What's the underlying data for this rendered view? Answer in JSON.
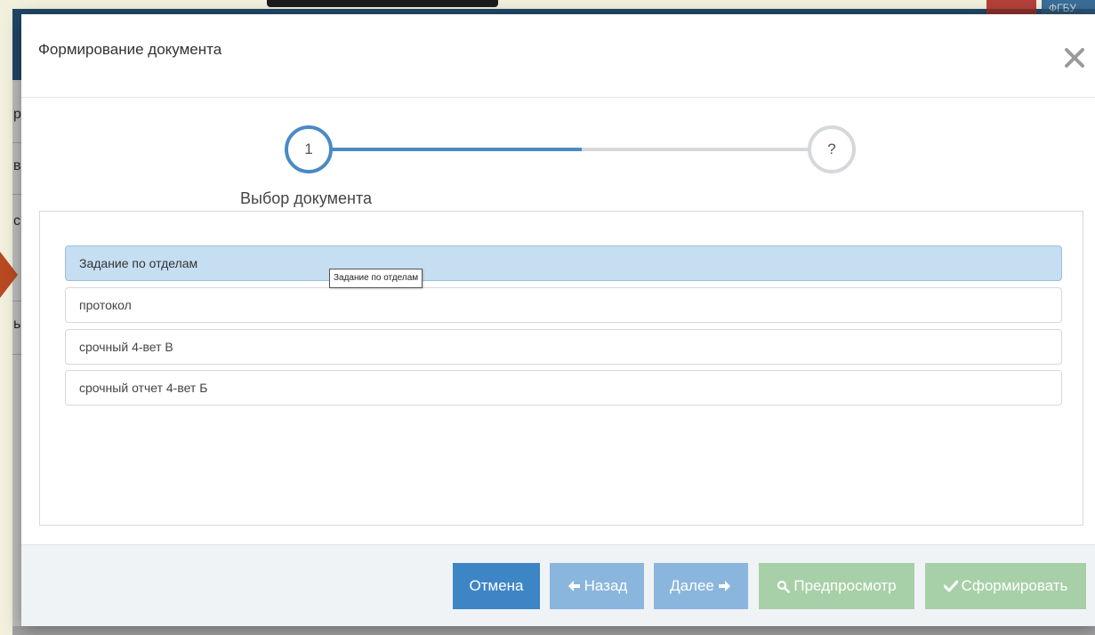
{
  "background": {
    "topbar_right_text": "ФГБУ",
    "side_letters": [
      "р",
      "в",
      "с",
      "ь"
    ]
  },
  "modal": {
    "title": "Формирование документа",
    "close_icon": "close-icon",
    "stepper": {
      "steps": [
        {
          "label": "1",
          "state": "active"
        },
        {
          "label": "?",
          "state": "pending"
        }
      ],
      "current_step_label": "Выбор документа",
      "progress_fraction": 0.5
    },
    "documents": [
      {
        "label": "Задание по отделам",
        "selected": true
      },
      {
        "label": "протокол",
        "selected": false
      },
      {
        "label": "срочный 4-вет В",
        "selected": false
      },
      {
        "label": "срочный отчет 4-вет Б",
        "selected": false
      }
    ],
    "tooltip": "Задание по отделам",
    "footer": {
      "cancel_label": "Отмена",
      "back_label": "Назад",
      "next_label": "Далее",
      "preview_label": "Предпросмотр",
      "form_label": "Сформировать"
    }
  },
  "colors": {
    "primary": "#3e85c6",
    "primary_disabled": "#8ab6de",
    "success_disabled": "#a8d0a8",
    "selected_row": "#c6def2",
    "accent_arrow": "#b84a22"
  }
}
